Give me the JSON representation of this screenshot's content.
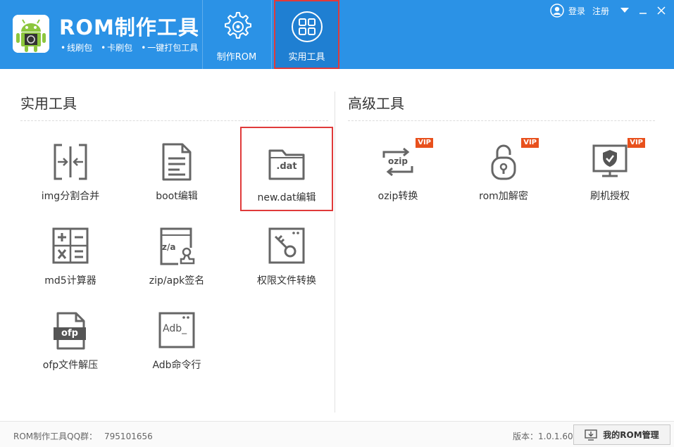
{
  "header": {
    "app_title": "ROM制作工具",
    "features": [
      "线刷包",
      "卡刷包",
      "一键打包工具"
    ],
    "tabs": [
      {
        "label": "制作ROM"
      },
      {
        "label": "实用工具"
      }
    ],
    "login": "登录",
    "register": "注册"
  },
  "left_section": {
    "title": "实用工具",
    "tools": [
      {
        "label": "img分割合并",
        "icon": "split-merge-icon"
      },
      {
        "label": "boot编辑",
        "icon": "document-icon"
      },
      {
        "label": "new.dat编辑",
        "icon": "folder-dat-icon",
        "icon_text": ".dat"
      },
      {
        "label": "md5计算器",
        "icon": "calculator-icon"
      },
      {
        "label": "zip/apk签名",
        "icon": "signature-stamp-icon",
        "icon_text": "z/a"
      },
      {
        "label": "权限文件转换",
        "icon": "key-file-icon"
      },
      {
        "label": "ofp文件解压",
        "icon": "ofp-file-icon",
        "icon_text": "ofp"
      },
      {
        "label": "Adb命令行",
        "icon": "terminal-icon",
        "icon_text": "Adb_"
      }
    ]
  },
  "right_section": {
    "title": "高级工具",
    "tools": [
      {
        "label": "ozip转换",
        "icon": "ozip-convert-icon",
        "icon_text": "ozip",
        "badge": "VIP"
      },
      {
        "label": "rom加解密",
        "icon": "lock-icon",
        "badge": "VIP"
      },
      {
        "label": "刷机授权",
        "icon": "shield-monitor-icon",
        "badge": "VIP"
      }
    ]
  },
  "footer": {
    "qq_label": "ROM制作工具QQ群：",
    "qq_number": "795101656",
    "version": "版本：1.0.1.60",
    "my_rom_button": "我的ROM管理"
  },
  "colors": {
    "header_bg": "#2b92e6",
    "active_tab_bg": "#1f7fd2",
    "highlight_border": "#e03a3a",
    "vip_badge": "#e8501c",
    "icon_gray": "#666666"
  }
}
